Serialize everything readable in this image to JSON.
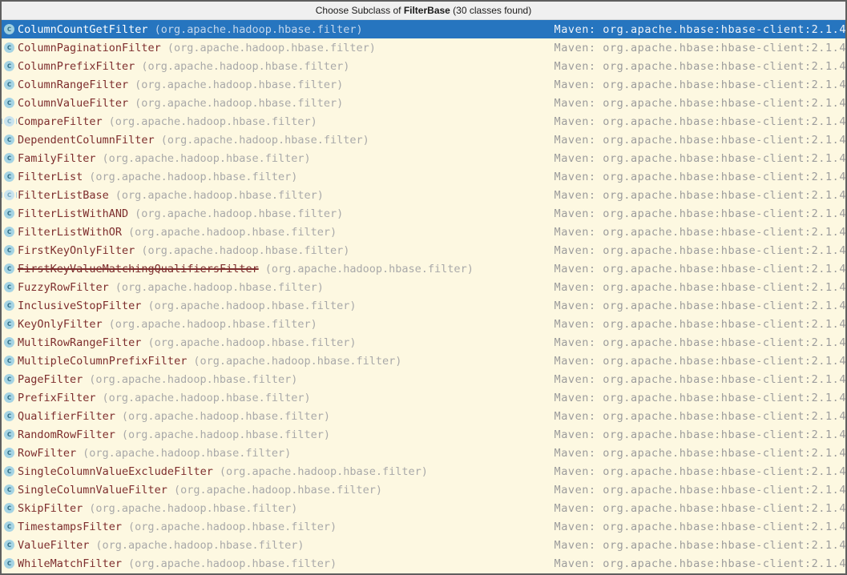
{
  "window": {
    "title": {
      "prefix": "Choose Subclass of ",
      "emphasis": "FilterBase",
      "suffix": " (30 classes found)"
    }
  },
  "list": {
    "package": "(org.apache.hadoop.hbase.filter)",
    "location": "Maven: org.apache.hbase:hbase-client:2.1.4",
    "icon_glyph": "c",
    "items": [
      {
        "name": "ColumnCountGetFilter",
        "selected": true,
        "abstract": false,
        "deprecated": false
      },
      {
        "name": "ColumnPaginationFilter",
        "selected": false,
        "abstract": false,
        "deprecated": false
      },
      {
        "name": "ColumnPrefixFilter",
        "selected": false,
        "abstract": false,
        "deprecated": false
      },
      {
        "name": "ColumnRangeFilter",
        "selected": false,
        "abstract": false,
        "deprecated": false
      },
      {
        "name": "ColumnValueFilter",
        "selected": false,
        "abstract": false,
        "deprecated": false
      },
      {
        "name": "CompareFilter",
        "selected": false,
        "abstract": true,
        "deprecated": false
      },
      {
        "name": "DependentColumnFilter",
        "selected": false,
        "abstract": false,
        "deprecated": false
      },
      {
        "name": "FamilyFilter",
        "selected": false,
        "abstract": false,
        "deprecated": false
      },
      {
        "name": "FilterList",
        "selected": false,
        "abstract": false,
        "deprecated": false
      },
      {
        "name": "FilterListBase",
        "selected": false,
        "abstract": true,
        "deprecated": false
      },
      {
        "name": "FilterListWithAND",
        "selected": false,
        "abstract": false,
        "deprecated": false
      },
      {
        "name": "FilterListWithOR",
        "selected": false,
        "abstract": false,
        "deprecated": false
      },
      {
        "name": "FirstKeyOnlyFilter",
        "selected": false,
        "abstract": false,
        "deprecated": false
      },
      {
        "name": "FirstKeyValueMatchingQualifiersFilter",
        "selected": false,
        "abstract": false,
        "deprecated": true
      },
      {
        "name": "FuzzyRowFilter",
        "selected": false,
        "abstract": false,
        "deprecated": false
      },
      {
        "name": "InclusiveStopFilter",
        "selected": false,
        "abstract": false,
        "deprecated": false
      },
      {
        "name": "KeyOnlyFilter",
        "selected": false,
        "abstract": false,
        "deprecated": false
      },
      {
        "name": "MultiRowRangeFilter",
        "selected": false,
        "abstract": false,
        "deprecated": false
      },
      {
        "name": "MultipleColumnPrefixFilter",
        "selected": false,
        "abstract": false,
        "deprecated": false
      },
      {
        "name": "PageFilter",
        "selected": false,
        "abstract": false,
        "deprecated": false
      },
      {
        "name": "PrefixFilter",
        "selected": false,
        "abstract": false,
        "deprecated": false
      },
      {
        "name": "QualifierFilter",
        "selected": false,
        "abstract": false,
        "deprecated": false
      },
      {
        "name": "RandomRowFilter",
        "selected": false,
        "abstract": false,
        "deprecated": false
      },
      {
        "name": "RowFilter",
        "selected": false,
        "abstract": false,
        "deprecated": false
      },
      {
        "name": "SingleColumnValueExcludeFilter",
        "selected": false,
        "abstract": false,
        "deprecated": false
      },
      {
        "name": "SingleColumnValueFilter",
        "selected": false,
        "abstract": false,
        "deprecated": false
      },
      {
        "name": "SkipFilter",
        "selected": false,
        "abstract": false,
        "deprecated": false
      },
      {
        "name": "TimestampsFilter",
        "selected": false,
        "abstract": false,
        "deprecated": false
      },
      {
        "name": "ValueFilter",
        "selected": false,
        "abstract": false,
        "deprecated": false
      },
      {
        "name": "WhileMatchFilter",
        "selected": false,
        "abstract": false,
        "deprecated": false
      }
    ]
  },
  "colors": {
    "selection_bg": "#2675bf",
    "row_bg": "#fdf8e1",
    "class_name": "#7d2d2d",
    "package_text": "#a9a9a9",
    "location_text": "#9c9c9c",
    "icon_bg": "#a5d4e4",
    "icon_letter": "#2f6e87",
    "titlebar_bg": "#f0f0f0",
    "window_border": "#5f5f5f"
  }
}
